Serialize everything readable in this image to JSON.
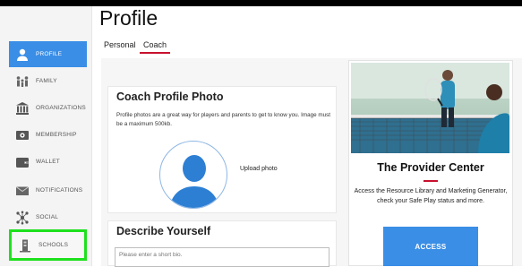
{
  "page": {
    "title": "Profile"
  },
  "tabs": [
    {
      "label": "Personal",
      "active": false
    },
    {
      "label": "Coach",
      "active": true
    }
  ],
  "sidebar": {
    "items": [
      {
        "label": "PROFILE",
        "icon": "person-icon",
        "active": true
      },
      {
        "label": "FAMILY",
        "icon": "family-icon"
      },
      {
        "label": "ORGANIZATIONS",
        "icon": "building-icon"
      },
      {
        "label": "MEMBERSHIP",
        "icon": "membership-card-icon"
      },
      {
        "label": "WALLET",
        "icon": "wallet-icon"
      },
      {
        "label": "NOTIFICATIONS",
        "icon": "envelope-icon"
      },
      {
        "label": "SOCIAL",
        "icon": "network-icon"
      },
      {
        "label": "SCHOOLS",
        "icon": "school-building-icon",
        "highlighted": true
      }
    ]
  },
  "photo_card": {
    "heading": "Coach Profile Photo",
    "description": "Profile photos are a great way for players and parents to get to know you. Image must be a maximum 500kb.",
    "upload_label": "Upload photo"
  },
  "bio_card": {
    "heading": "Describe Yourself",
    "placeholder": "Please enter a short bio."
  },
  "provider": {
    "title": "The Provider Center",
    "text": "Access the Resource Library and Marketing Generator, check your Safe Play status and more.",
    "button": "ACCESS"
  },
  "colors": {
    "accent": "#3a8ee6",
    "red": "#c8102e",
    "highlight": "#1ee01e"
  }
}
